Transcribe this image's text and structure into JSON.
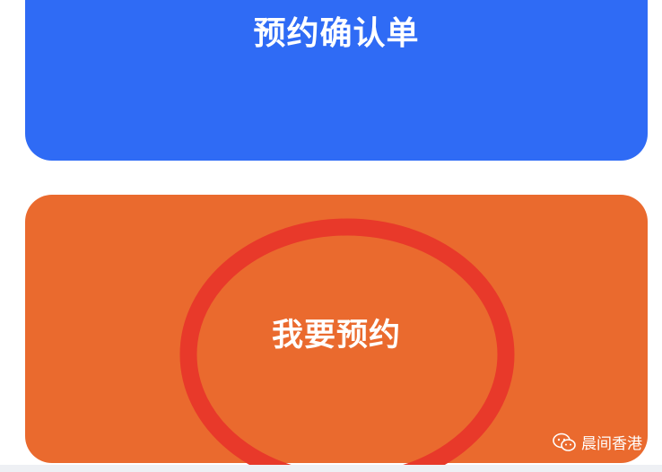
{
  "confirmation_card": {
    "label": "预约确认单"
  },
  "reserve_card": {
    "label": "我要预约"
  },
  "watermark": {
    "text": "晨间香港",
    "icon": "wechat-icon"
  },
  "colors": {
    "blue": "#2f6bf5",
    "orange": "#ea6a2e",
    "annotation_red": "#e8392a"
  }
}
